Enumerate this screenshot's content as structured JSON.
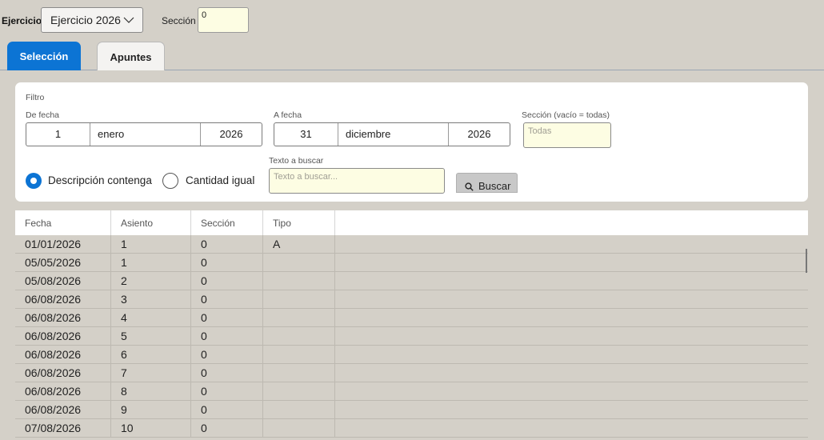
{
  "header": {
    "ejercicio_label": "Ejercicio",
    "ejercicio_value": "Ejercicio 2026",
    "seccion_label": "Sección",
    "seccion_value": "0"
  },
  "tabs": [
    {
      "label": "Selección",
      "active": true
    },
    {
      "label": "Apuntes",
      "active": false
    }
  ],
  "filter": {
    "title": "Filtro",
    "de_fecha_label": "De fecha",
    "de_fecha": {
      "day": "1",
      "month": "enero",
      "year": "2026"
    },
    "a_fecha_label": "A fecha",
    "a_fecha": {
      "day": "31",
      "month": "diciembre",
      "year": "2026"
    },
    "seccion_label": "Sección (vacío = todas)",
    "seccion_placeholder": "Todas",
    "texto_label": "Texto a buscar",
    "texto_placeholder": "Texto a buscar...",
    "radio_descripcion": "Descripción contenga",
    "radio_cantidad": "Cantidad igual",
    "radio_selected": "descripcion",
    "buscar_label": "Buscar"
  },
  "grid": {
    "columns": [
      "Fecha",
      "Asiento",
      "Sección",
      "Tipo"
    ],
    "rows": [
      [
        "01/01/2026",
        "1",
        "0",
        "A"
      ],
      [
        "05/05/2026",
        "1",
        "0",
        ""
      ],
      [
        "05/08/2026",
        "2",
        "0",
        ""
      ],
      [
        "06/08/2026",
        "3",
        "0",
        ""
      ],
      [
        "06/08/2026",
        "4",
        "0",
        ""
      ],
      [
        "06/08/2026",
        "5",
        "0",
        ""
      ],
      [
        "06/08/2026",
        "6",
        "0",
        ""
      ],
      [
        "06/08/2026",
        "7",
        "0",
        ""
      ],
      [
        "06/08/2026",
        "8",
        "0",
        ""
      ],
      [
        "06/08/2026",
        "9",
        "0",
        ""
      ],
      [
        "07/08/2026",
        "10",
        "0",
        ""
      ]
    ]
  },
  "colors": {
    "accent": "#0c74d4",
    "background": "#d4d0c8",
    "input_yellow": "#fdfde3"
  }
}
